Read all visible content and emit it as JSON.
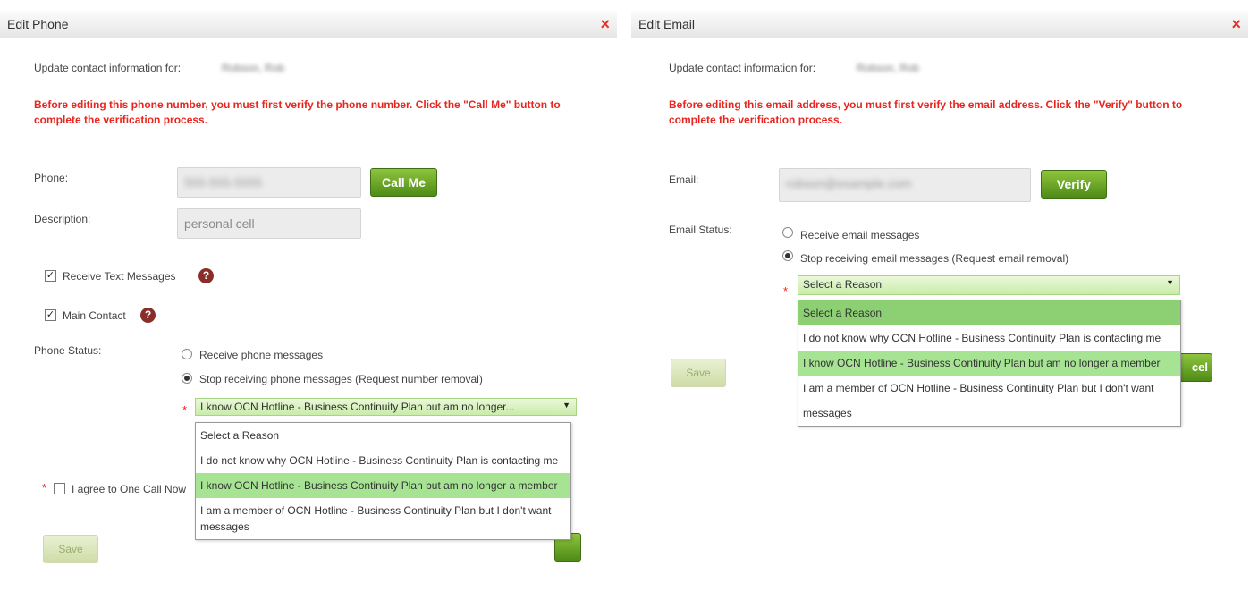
{
  "phone_dialog": {
    "title": "Edit Phone",
    "close_glyph": "×",
    "update_label": "Update contact information for:",
    "contact_name": "Robson, Rob",
    "warning": "Before editing this phone number, you must first verify the phone number. Click the \"Call Me\" button to complete the verification process.",
    "phone_label": "Phone:",
    "phone_value": "555-555-5555",
    "call_me_label": "Call Me",
    "description_label": "Description:",
    "description_value": "personal cell",
    "receive_text_label": "Receive Text Messages",
    "receive_text_checked": true,
    "main_contact_label": "Main Contact",
    "main_contact_checked": true,
    "help_glyph": "?",
    "status_label": "Phone Status:",
    "radio_receive": "Receive phone messages",
    "radio_stop": "Stop receiving phone messages (Request number removal)",
    "selected_option": "Stop receiving phone messages (Request number removal)",
    "required_mark": "*",
    "reason_select_value": "I know OCN Hotline - Business Continuity Plan but am no longer...",
    "reason_options": [
      "Select a Reason",
      "I do not know why OCN Hotline - Business Continuity Plan is contacting me",
      "I know OCN Hotline - Business Continuity Plan but am no longer a member",
      "I am a member of OCN Hotline - Business Continuity Plan but I don't want messages"
    ],
    "highlighted_option_index": 2,
    "agree_label": "I agree to One Call Now",
    "save_label": "Save"
  },
  "email_dialog": {
    "title": "Edit Email",
    "close_glyph": "×",
    "update_label": "Update contact information for:",
    "contact_name": "Robson, Rob",
    "warning": "Before editing this email address, you must first verify the email address. Click the \"Verify\" button to complete the verification process.",
    "email_label": "Email:",
    "email_value": "robson@example.com",
    "verify_label": "Verify",
    "status_label": "Email Status:",
    "radio_receive": "Receive email messages",
    "radio_stop": "Stop receiving email messages (Request email removal)",
    "selected_option": "Stop receiving email messages (Request email removal)",
    "required_mark": "*",
    "reason_select_value": "Select a Reason",
    "reason_options": [
      "Select a Reason",
      "I do not know why OCN Hotline - Business Continuity Plan is contacting me",
      "I know OCN Hotline - Business Continuity Plan but am no longer a member",
      "I am a member of OCN Hotline - Business Continuity Plan but I don't want messages"
    ],
    "highlighted_option_index": 2,
    "save_label": "Save",
    "cancel_partial_label": "cel"
  },
  "colors": {
    "warning_red": "#e8261f",
    "button_green": "#5b9a1e",
    "option_highlight": "#a6e494",
    "help_icon": "#8a2e2b"
  }
}
